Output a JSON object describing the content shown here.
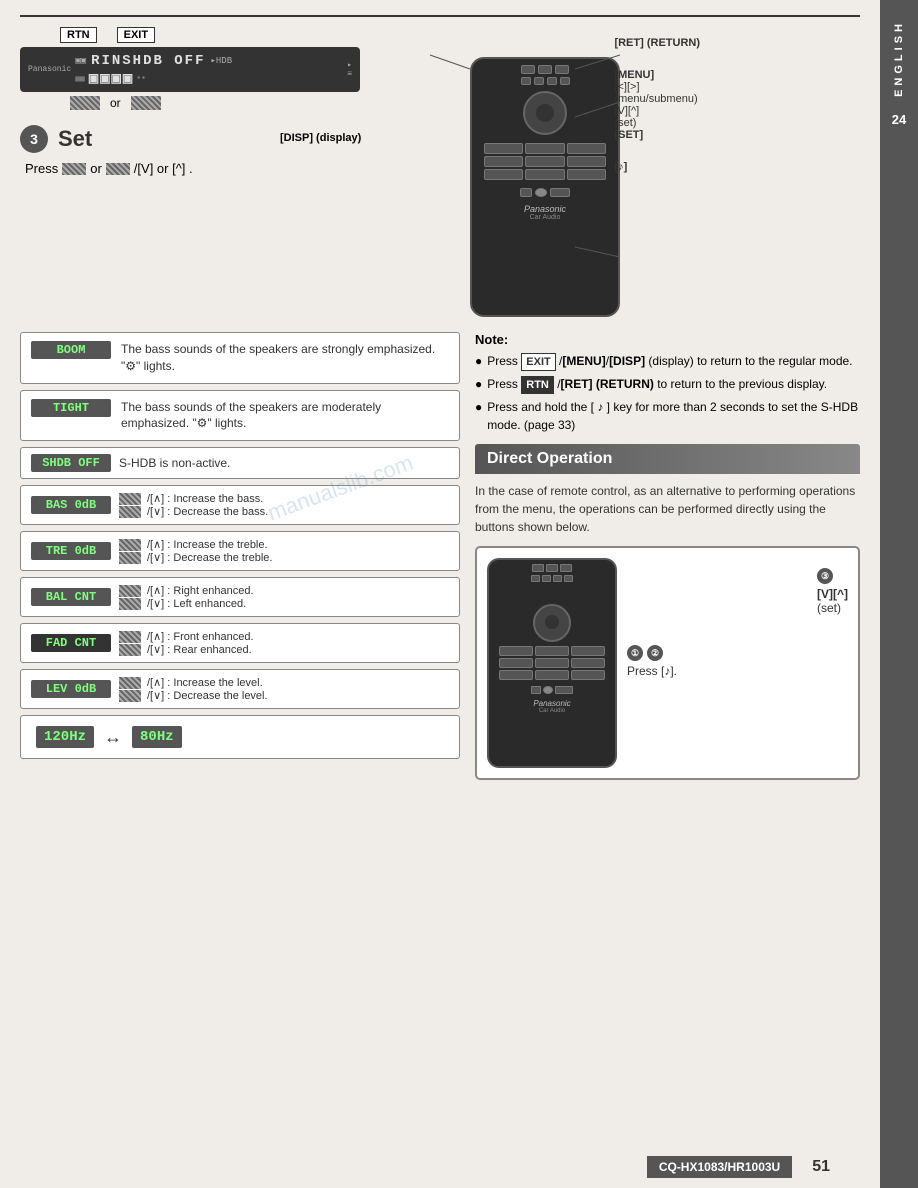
{
  "sidebar": {
    "language": "ENGLISH",
    "page_num": "24"
  },
  "header": {
    "title": "CQ-HX1083/HR1003U"
  },
  "top_display": {
    "logo": "Panasonic",
    "text": "RINSHDB OFF",
    "icons": "HDB"
  },
  "buttons": {
    "rtn": "RTN",
    "exit": "EXIT",
    "or": "or"
  },
  "step3": {
    "number": "3",
    "title": "Set",
    "instruction": "Press"
  },
  "remote_labels": {
    "ret_return": "[RET] (RETURN)",
    "menu": "[MENU]",
    "nav": "[<][>]",
    "nav_desc": "(menu/submenu)",
    "set_nav": "[V][^]",
    "set_desc": "(set)",
    "set_btn": "[SET]",
    "disp": "[DISP] (display)",
    "note_key": "[♪]"
  },
  "modes": [
    {
      "tag": "BOOM",
      "desc": "The bass sounds of the speakers are strongly emphasized. \"⚙\" lights."
    },
    {
      "tag": "TIGHT",
      "desc": "The bass sounds of the speakers are moderately emphasized. \"⚙\" lights."
    },
    {
      "tag": "SHDB OFF",
      "desc": "S-HDB is non-active."
    }
  ],
  "settings": [
    {
      "tag": "BAS  0dB",
      "up": "/[^] : Increase the bass.",
      "down": "/[V] : Decrease the bass."
    },
    {
      "tag": "TRE  0dB",
      "up": "/[^] : Increase the treble.",
      "down": "/[V] : Decrease the treble."
    },
    {
      "tag": "BAL CNT",
      "up": "/[^] : Right enhanced.",
      "down": "/[V] : Left enhanced."
    },
    {
      "tag": "FAD CNT",
      "up": "/[^] : Front enhanced.",
      "down": "/[V] : Rear enhanced."
    },
    {
      "tag": "LEV  0dB",
      "up": "/[^] : Increase the level.",
      "down": "/[V] : Decrease the level."
    }
  ],
  "frequency": {
    "left": "120Hz",
    "right": "80Hz"
  },
  "note": {
    "title": "Note:",
    "items": [
      "Press EXIT /[MENU]/[DISP] (display) to return to the regular mode.",
      "Press RTN /[RET] (RETURN) to return to the previous display.",
      "Press and hold the [ ♪ ] key for more than 2 seconds to set the S-HDB mode.  (page 33)"
    ]
  },
  "direct_op": {
    "title": "Direct Operation",
    "desc": "In the case of remote control, as an alternative to performing operations from the menu, the operations can be performed directly using the buttons shown below."
  },
  "direct_annotations": {
    "step1": "①",
    "step2": "②",
    "press_note": "Press [♪].",
    "step3_label": "③",
    "set_label": "[V][^]",
    "set_desc": "(set)"
  },
  "footer": {
    "model": "CQ-HX1083/HR1003U",
    "page": "51"
  },
  "watermark": "manualslib.com"
}
